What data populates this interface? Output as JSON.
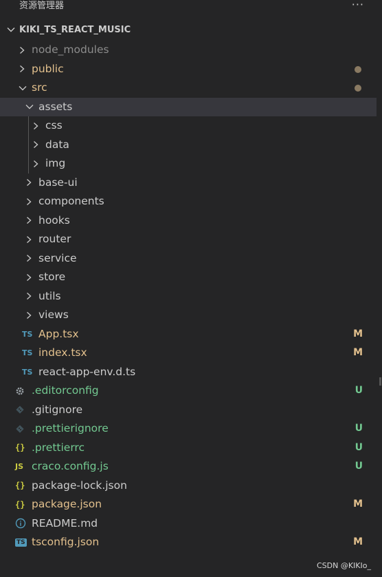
{
  "panel": {
    "title": "资源管理器",
    "more_actions": "···"
  },
  "project": {
    "name": "KIKI_TS_REACT_MUSIC"
  },
  "colors": {
    "folder_default": "#cccccc",
    "ignored": "#8c8c8c",
    "modified": "#e2c08d",
    "untracked": "#73c991",
    "selected_row": "#37373d"
  },
  "tree": [
    {
      "label": "node_modules",
      "type": "folder",
      "expanded": false,
      "status": "ignored"
    },
    {
      "label": "public",
      "type": "folder",
      "expanded": false,
      "status": "modified",
      "indicator": "dot"
    },
    {
      "label": "src",
      "type": "folder",
      "expanded": true,
      "status": "modified",
      "indicator": "dot"
    },
    {
      "label": "assets",
      "type": "folder",
      "expanded": true,
      "selected": true
    },
    {
      "label": "css",
      "type": "folder",
      "expanded": false
    },
    {
      "label": "data",
      "type": "folder",
      "expanded": false
    },
    {
      "label": "img",
      "type": "folder",
      "expanded": false
    },
    {
      "label": "base-ui",
      "type": "folder",
      "expanded": false
    },
    {
      "label": "components",
      "type": "folder",
      "expanded": false
    },
    {
      "label": "hooks",
      "type": "folder",
      "expanded": false
    },
    {
      "label": "router",
      "type": "folder",
      "expanded": false
    },
    {
      "label": "service",
      "type": "folder",
      "expanded": false
    },
    {
      "label": "store",
      "type": "folder",
      "expanded": false
    },
    {
      "label": "utils",
      "type": "folder",
      "expanded": false
    },
    {
      "label": "views",
      "type": "folder",
      "expanded": false
    },
    {
      "label": "App.tsx",
      "type": "file",
      "icon": "typescript-icon",
      "icon_text": "TS",
      "status": "modified",
      "badge": "M"
    },
    {
      "label": "index.tsx",
      "type": "file",
      "icon": "typescript-icon",
      "icon_text": "TS",
      "status": "modified",
      "badge": "M"
    },
    {
      "label": "react-app-env.d.ts",
      "type": "file",
      "icon": "typescript-icon",
      "icon_text": "TS"
    },
    {
      "label": ".editorconfig",
      "type": "file",
      "icon": "gear-icon",
      "status": "untracked",
      "badge": "U"
    },
    {
      "label": ".gitignore",
      "type": "file",
      "icon": "git-icon"
    },
    {
      "label": ".prettierignore",
      "type": "file",
      "icon": "git-icon",
      "status": "untracked",
      "badge": "U"
    },
    {
      "label": ".prettierrc",
      "type": "file",
      "icon": "json-icon",
      "icon_text": "{}",
      "status": "untracked",
      "badge": "U"
    },
    {
      "label": "craco.config.js",
      "type": "file",
      "icon": "javascript-icon",
      "icon_text": "JS",
      "status": "untracked",
      "badge": "U"
    },
    {
      "label": "package-lock.json",
      "type": "file",
      "icon": "json-icon",
      "icon_text": "{}"
    },
    {
      "label": "package.json",
      "type": "file",
      "icon": "json-icon",
      "icon_text": "{}",
      "status": "modified",
      "badge": "M"
    },
    {
      "label": "README.md",
      "type": "file",
      "icon": "info-icon"
    },
    {
      "label": "tsconfig.json",
      "type": "file",
      "icon": "tsconfig-icon",
      "icon_text": "TS",
      "status": "modified",
      "badge": "M"
    }
  ],
  "watermark": "CSDN @KIKIo_"
}
